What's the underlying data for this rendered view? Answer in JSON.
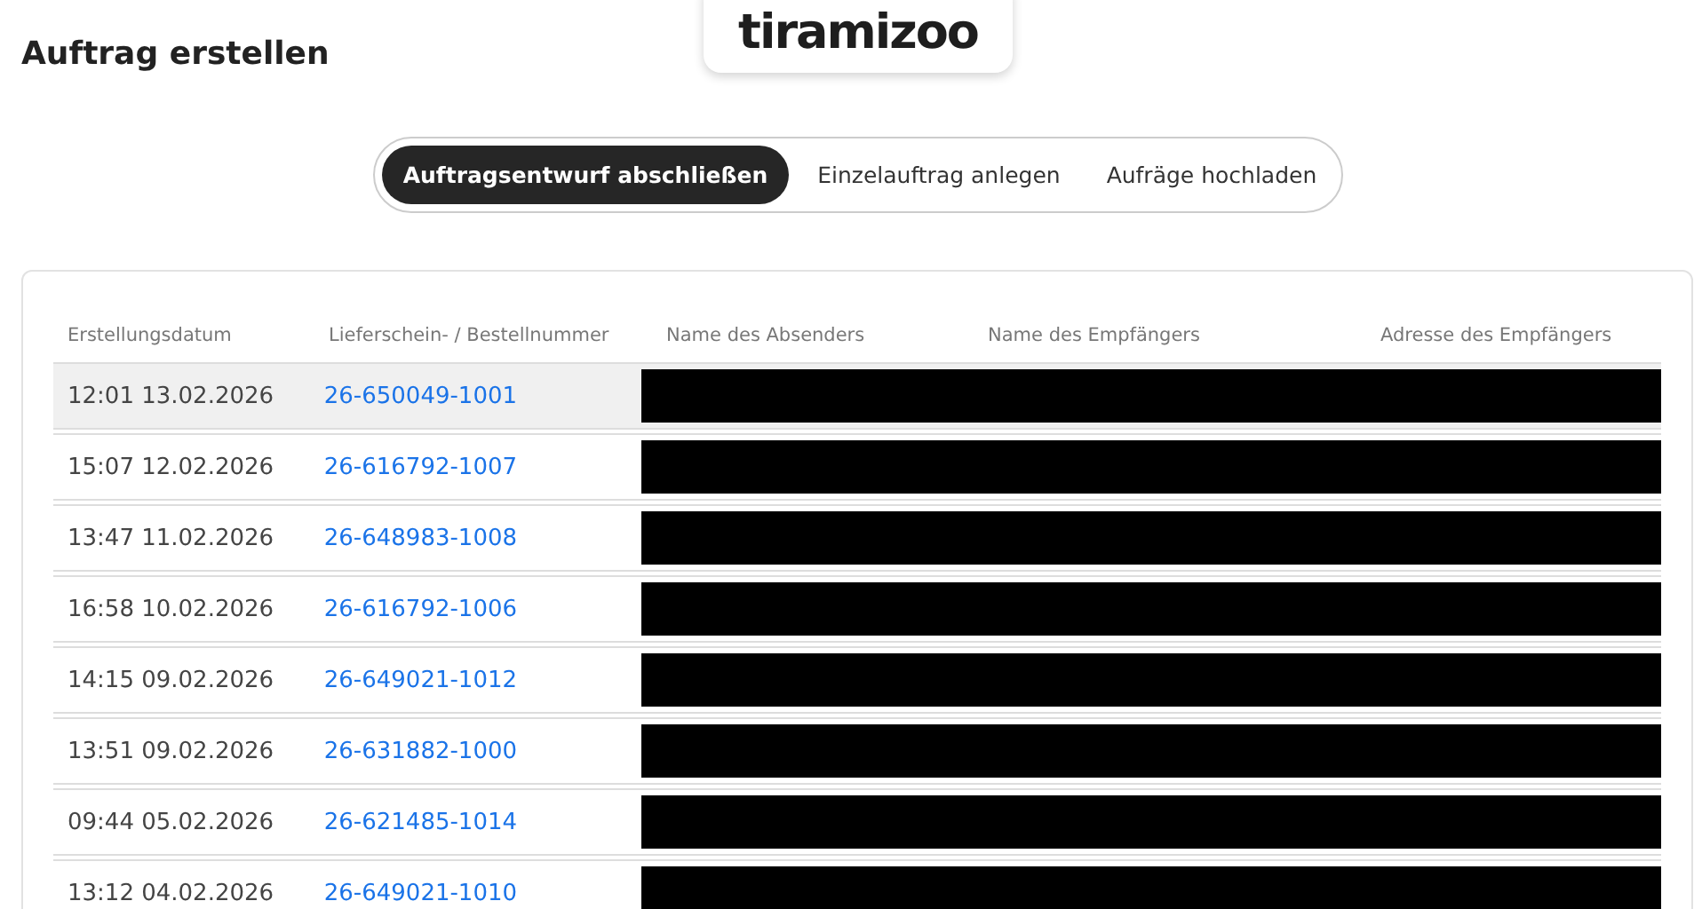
{
  "logo": "tiramizoo",
  "page_title": "Auftrag erstellen",
  "tabs": [
    {
      "label": "Auftragsentwurf abschließen",
      "selected": true
    },
    {
      "label": "Einzelauftrag anlegen",
      "selected": false
    },
    {
      "label": "Aufräge hochladen",
      "selected": false
    }
  ],
  "table": {
    "columns": [
      "Erstellungsdatum",
      "Lieferschein- / Bestellnummer",
      "Name des Absenders",
      "Name des Empfängers",
      "Adresse des Empfängers"
    ],
    "rows": [
      {
        "date": "12:01 13.02.2026",
        "number": "26-650049-1001",
        "selected": true
      },
      {
        "date": "15:07 12.02.2026",
        "number": "26-616792-1007",
        "selected": false
      },
      {
        "date": "13:47 11.02.2026",
        "number": "26-648983-1008",
        "selected": false
      },
      {
        "date": "16:58 10.02.2026",
        "number": "26-616792-1006",
        "selected": false
      },
      {
        "date": "14:15 09.02.2026",
        "number": "26-649021-1012",
        "selected": false
      },
      {
        "date": "13:51 09.02.2026",
        "number": "26-631882-1000",
        "selected": false
      },
      {
        "date": "09:44 05.02.2026",
        "number": "26-621485-1014",
        "selected": false
      },
      {
        "date": "13:12 04.02.2026",
        "number": "26-649021-1010",
        "selected": false
      }
    ]
  }
}
